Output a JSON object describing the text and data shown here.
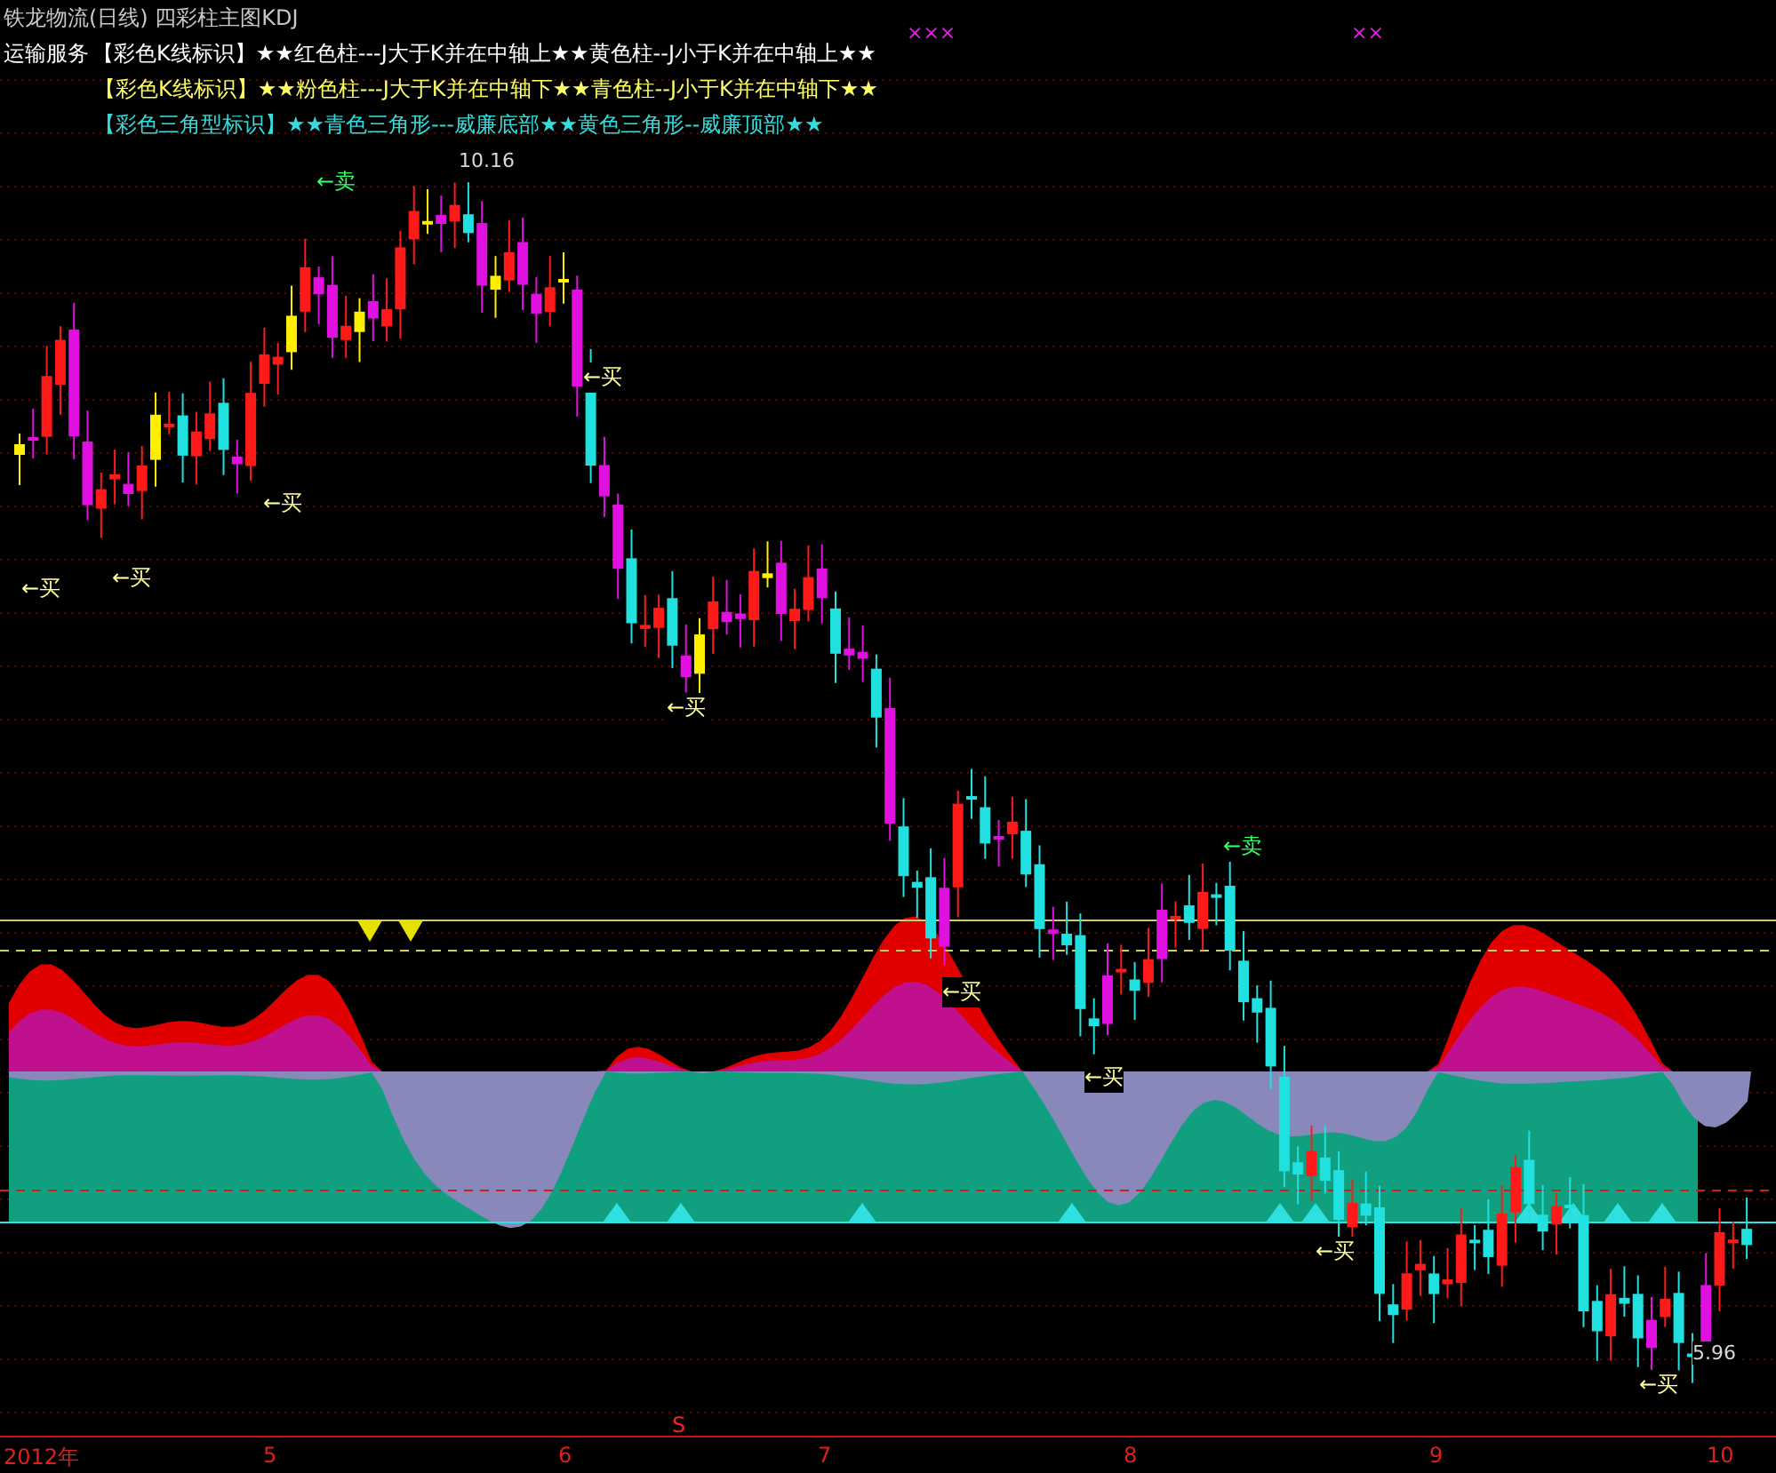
{
  "header": {
    "title": "铁龙物流(日线) 四彩柱主图KDJ",
    "sector": "运输服务",
    "legend": [
      {
        "text": "【彩色K线标识】★★红色柱---J大于K并在中轴上★★黄色柱--J小于K并在中轴上★★",
        "color": "#ffffff"
      },
      {
        "text": "【彩色K线标识】★★粉色柱---J大于K并在中轴下★★青色柱--J小于K并在中轴下★★",
        "color": "#ffff66"
      },
      {
        "text": "【彩色三角型标识】★★青色三角形---威廉底部★★黄色三角形--威廉顶部★★",
        "color": "#33dddd"
      }
    ]
  },
  "chart": {
    "marks": [
      "×××",
      "××"
    ],
    "signals": [
      {
        "kind": "sell",
        "text": "←卖"
      },
      {
        "kind": "buy",
        "text": "←买"
      },
      {
        "kind": "buy",
        "text": "←买"
      },
      {
        "kind": "buy",
        "text": "←买"
      },
      {
        "kind": "buy",
        "text": "←买"
      },
      {
        "kind": "buy",
        "text": "←买"
      },
      {
        "kind": "buy",
        "text": "←买"
      },
      {
        "kind": "sell",
        "text": "←卖"
      },
      {
        "kind": "buy",
        "text": "←买"
      },
      {
        "kind": "buy",
        "text": "←买"
      },
      {
        "kind": "buy",
        "text": "←买"
      }
    ],
    "price_labels": [
      "10.16",
      "5.96"
    ]
  },
  "axis": {
    "marker": "S",
    "labels": [
      "2012年",
      "5",
      "6",
      "7",
      "8",
      "9",
      "10"
    ]
  }
}
